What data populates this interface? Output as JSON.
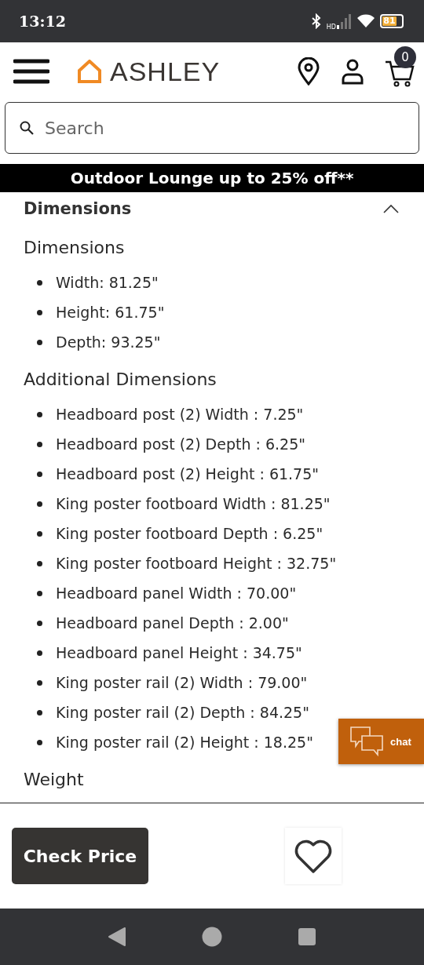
{
  "status_bar": {
    "time": "13:12",
    "network": "HD",
    "battery": "81"
  },
  "header": {
    "logo": "ASHLEY",
    "cart_count": "0"
  },
  "search": {
    "placeholder": "Search"
  },
  "promo": "Outdoor Lounge up to 25% off**",
  "section": {
    "title": "Dimensions",
    "expanded": true,
    "groups": [
      {
        "heading": "Dimensions",
        "items": [
          "Width: 81.25\"",
          "Height: 61.75\"",
          "Depth: 93.25\""
        ]
      },
      {
        "heading": "Additional Dimensions",
        "items": [
          "Headboard post (2) Width : 7.25\"",
          "Headboard post (2) Depth : 6.25\"",
          "Headboard post (2) Height : 61.75\"",
          "King poster footboard Width : 81.25\"",
          "King poster footboard Depth : 6.25\"",
          "King poster footboard Height : 32.75\"",
          "Headboard panel Width : 70.00\"",
          "Headboard panel Depth : 2.00\"",
          "Headboard panel Height : 34.75\"",
          "King poster rail (2) Width : 79.00\"",
          "King poster rail (2) Depth : 84.25\"",
          "King poster rail (2) Height : 18.25\""
        ]
      },
      {
        "heading": "Weight"
      }
    ]
  },
  "chat": {
    "label": "chat"
  },
  "footer": {
    "button": "Check Price"
  }
}
